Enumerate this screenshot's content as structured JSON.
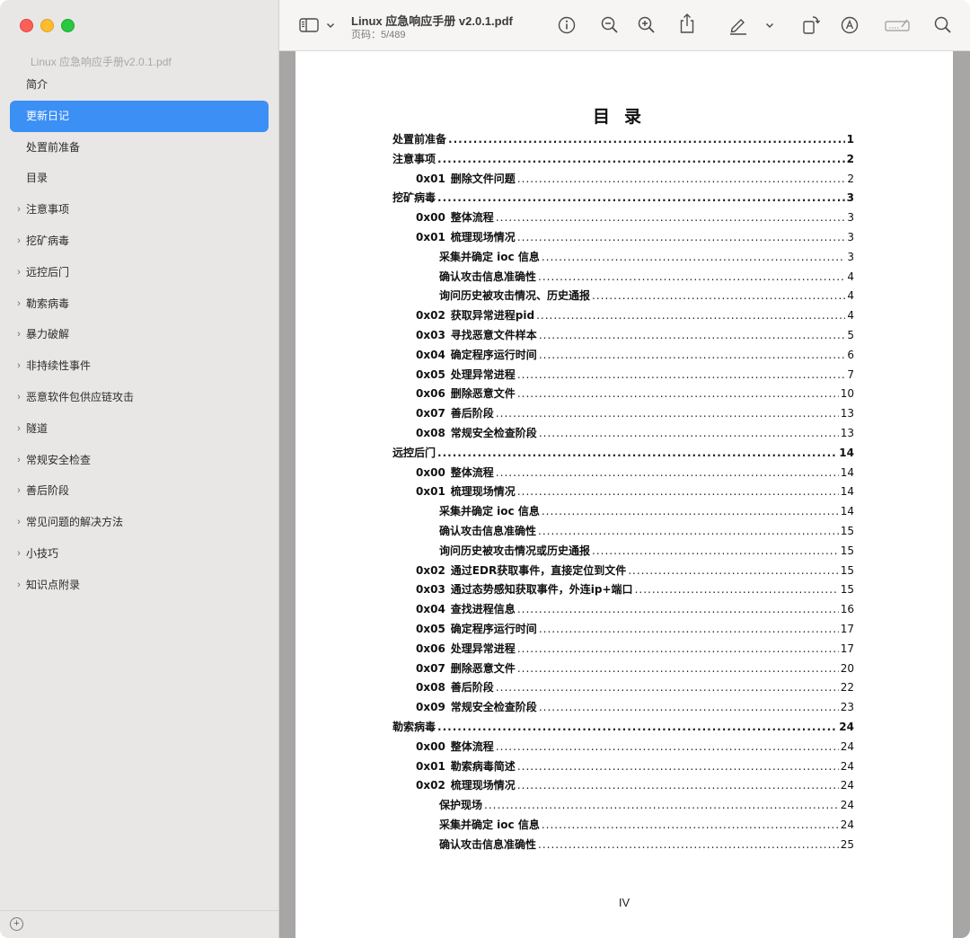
{
  "window": {
    "title": "Linux 应急响应手册 v2.0.1.pdf",
    "subtitle": "页码：5/489"
  },
  "sidebar": {
    "doc_name": "Linux 应急响应手册v2.0.1.pdf",
    "items": [
      {
        "label": "简介",
        "chevron": false,
        "selected": false
      },
      {
        "label": "更新日记",
        "chevron": false,
        "selected": true
      },
      {
        "label": "处置前准备",
        "chevron": false,
        "selected": false
      },
      {
        "label": "目录",
        "chevron": false,
        "selected": false
      },
      {
        "label": "注意事项",
        "chevron": true,
        "selected": false
      },
      {
        "label": "挖矿病毒",
        "chevron": true,
        "selected": false
      },
      {
        "label": "远控后门",
        "chevron": true,
        "selected": false
      },
      {
        "label": "勒索病毒",
        "chevron": true,
        "selected": false
      },
      {
        "label": "暴力破解",
        "chevron": true,
        "selected": false
      },
      {
        "label": "非持续性事件",
        "chevron": true,
        "selected": false
      },
      {
        "label": "恶意软件包供应链攻击",
        "chevron": true,
        "selected": false
      },
      {
        "label": "隧道",
        "chevron": true,
        "selected": false
      },
      {
        "label": "常规安全检查",
        "chevron": true,
        "selected": false
      },
      {
        "label": "善后阶段",
        "chevron": true,
        "selected": false
      },
      {
        "label": "常见问题的解决方法",
        "chevron": true,
        "selected": false
      },
      {
        "label": "小技巧",
        "chevron": true,
        "selected": false
      },
      {
        "label": "知识点附录",
        "chevron": true,
        "selected": false
      }
    ]
  },
  "page": {
    "heading": "目录",
    "footer": "IV",
    "toc": [
      {
        "level": 0,
        "num": "",
        "text": "处置前准备",
        "page": "1"
      },
      {
        "level": 0,
        "num": "",
        "text": "注意事项",
        "page": "2"
      },
      {
        "level": 1,
        "num": "0x01",
        "text": "删除文件问题",
        "page": "2"
      },
      {
        "level": 0,
        "num": "",
        "text": "挖矿病毒",
        "page": "3"
      },
      {
        "level": 1,
        "num": "0x00",
        "text": "整体流程",
        "page": "3"
      },
      {
        "level": 1,
        "num": "0x01",
        "text": "梳理现场情况",
        "page": "3"
      },
      {
        "level": 2,
        "num": "",
        "text": "采集并确定 ioc 信息",
        "page": "3"
      },
      {
        "level": 2,
        "num": "",
        "text": "确认攻击信息准确性",
        "page": "4"
      },
      {
        "level": 2,
        "num": "",
        "text": "询问历史被攻击情况、历史通报",
        "page": "4"
      },
      {
        "level": 1,
        "num": "0x02",
        "text": "获取异常进程pid",
        "page": "4"
      },
      {
        "level": 1,
        "num": "0x03",
        "text": "寻找恶意文件样本",
        "page": "5"
      },
      {
        "level": 1,
        "num": "0x04",
        "text": "确定程序运行时间",
        "page": "6"
      },
      {
        "level": 1,
        "num": "0x05",
        "text": "处理异常进程",
        "page": "7"
      },
      {
        "level": 1,
        "num": "0x06",
        "text": "删除恶意文件",
        "page": "10"
      },
      {
        "level": 1,
        "num": "0x07",
        "text": "善后阶段",
        "page": "13"
      },
      {
        "level": 1,
        "num": "0x08",
        "text": "常规安全检查阶段",
        "page": "13"
      },
      {
        "level": 0,
        "num": "",
        "text": "远控后门",
        "page": "14"
      },
      {
        "level": 1,
        "num": "0x00",
        "text": "整体流程",
        "page": "14"
      },
      {
        "level": 1,
        "num": "0x01",
        "text": "梳理现场情况",
        "page": "14"
      },
      {
        "level": 2,
        "num": "",
        "text": "采集并确定 ioc 信息",
        "page": "14"
      },
      {
        "level": 2,
        "num": "",
        "text": "确认攻击信息准确性",
        "page": "15"
      },
      {
        "level": 2,
        "num": "",
        "text": "询问历史被攻击情况或历史通报",
        "page": "15"
      },
      {
        "level": 1,
        "num": "0x02",
        "text": "通过EDR获取事件，直接定位到文件",
        "page": "15"
      },
      {
        "level": 1,
        "num": "0x03",
        "text": "通过态势感知获取事件，外连ip+端口",
        "page": "15"
      },
      {
        "level": 1,
        "num": "0x04",
        "text": "查找进程信息",
        "page": "16"
      },
      {
        "level": 1,
        "num": "0x05",
        "text": "确定程序运行时间",
        "page": "17"
      },
      {
        "level": 1,
        "num": "0x06",
        "text": "处理异常进程",
        "page": "17"
      },
      {
        "level": 1,
        "num": "0x07",
        "text": "删除恶意文件",
        "page": "20"
      },
      {
        "level": 1,
        "num": "0x08",
        "text": "善后阶段",
        "page": "22"
      },
      {
        "level": 1,
        "num": "0x09",
        "text": "常规安全检查阶段",
        "page": "23"
      },
      {
        "level": 0,
        "num": "",
        "text": "勒索病毒",
        "page": "24"
      },
      {
        "level": 1,
        "num": "0x00",
        "text": "整体流程",
        "page": "24"
      },
      {
        "level": 1,
        "num": "0x01",
        "text": "勒索病毒简述",
        "page": "24"
      },
      {
        "level": 1,
        "num": "0x02",
        "text": "梳理现场情况",
        "page": "24"
      },
      {
        "level": 2,
        "num": "",
        "text": "保护现场",
        "page": "24"
      },
      {
        "level": 2,
        "num": "",
        "text": "采集并确定 ioc 信息",
        "page": "24"
      },
      {
        "level": 2,
        "num": "",
        "text": "确认攻击信息准确性",
        "page": "25"
      }
    ]
  },
  "toolbar": {
    "icons": [
      "sidebar-toggle-icon",
      "chevron-down-icon",
      "info-icon",
      "zoom-out-icon",
      "zoom-in-icon",
      "share-icon",
      "highlight-icon",
      "chevron-down-icon",
      "rotate-icon",
      "markup-icon",
      "form-fill-icon",
      "search-icon"
    ]
  },
  "colors": {
    "selection": "#3b8ff5",
    "sidebar_bg": "#e8e7e6",
    "content_bg": "#a7a6a5"
  }
}
